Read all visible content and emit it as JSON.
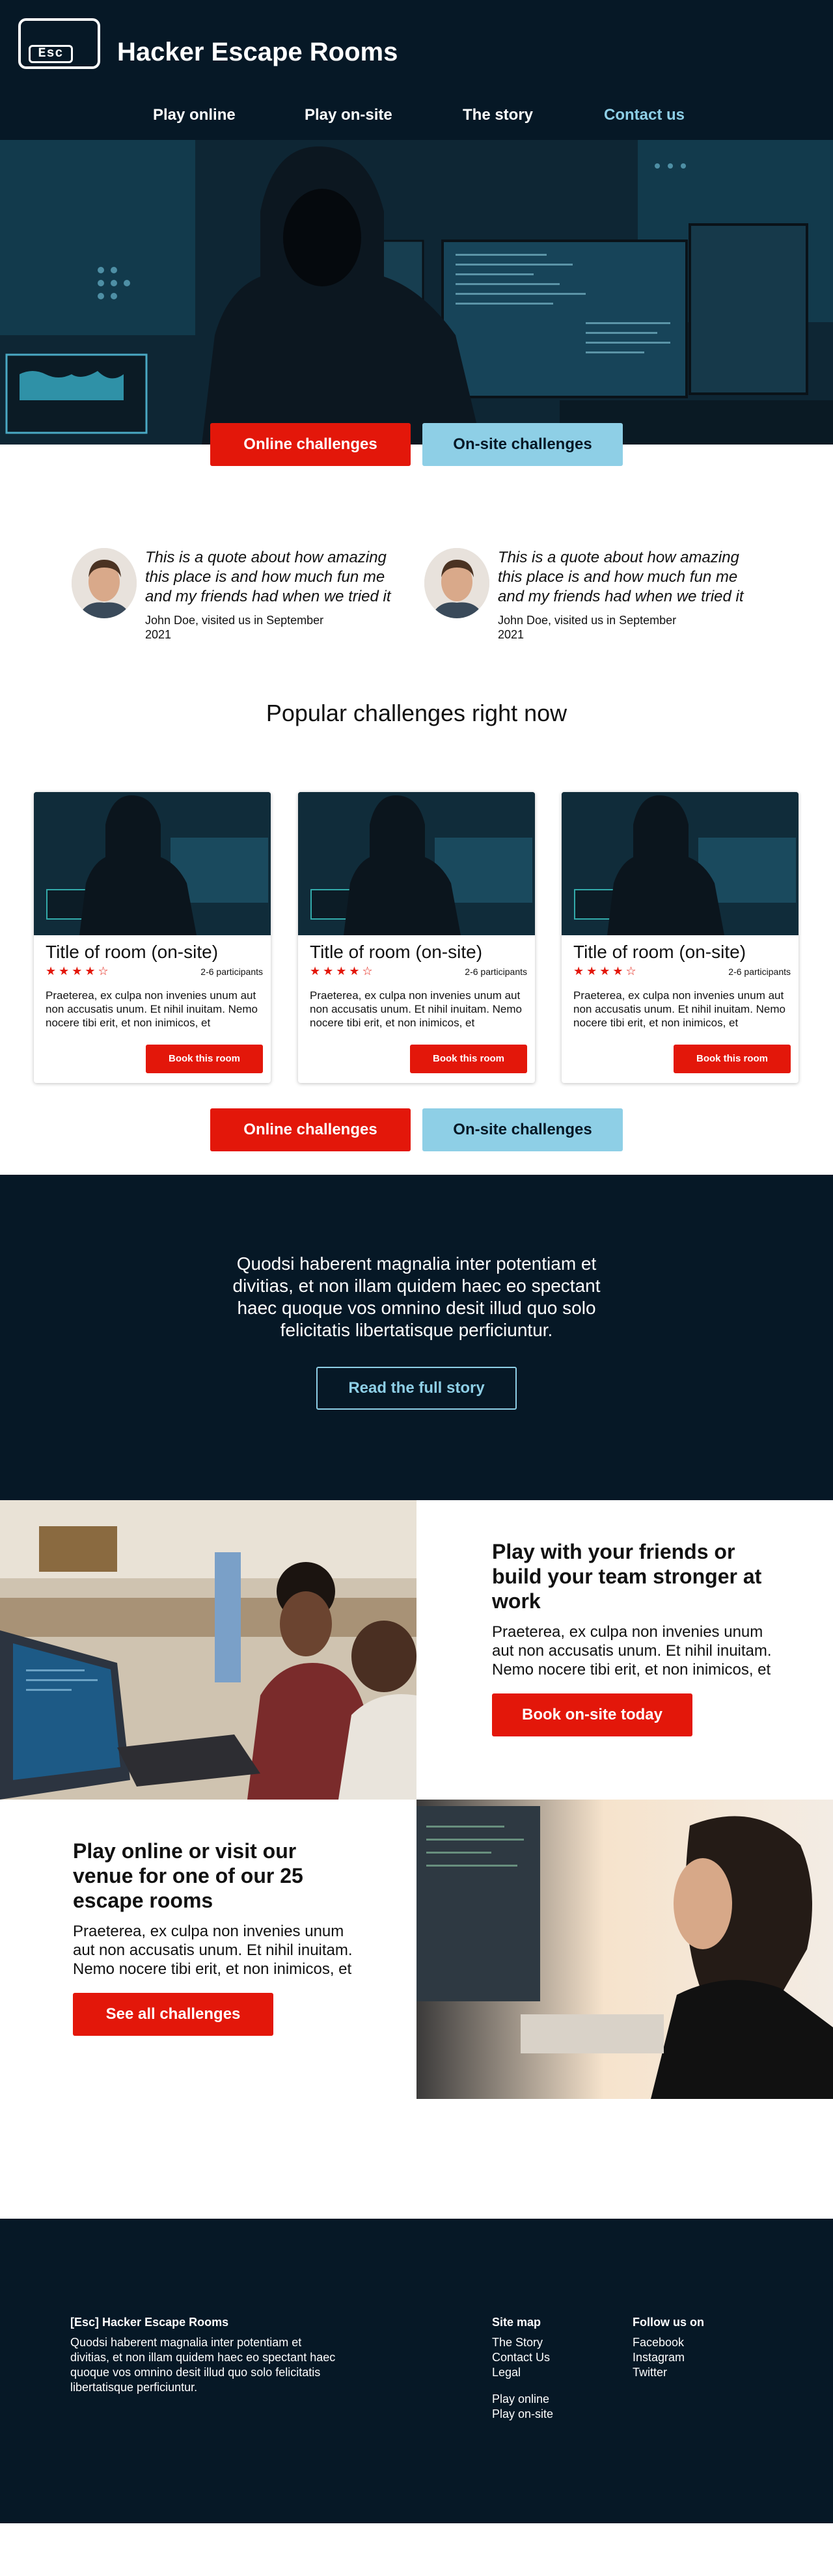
{
  "header": {
    "logo_key": "Esc",
    "brand": "Hacker Escape Rooms",
    "nav": [
      {
        "label": "Play online"
      },
      {
        "label": "Play on-site"
      },
      {
        "label": "The story"
      },
      {
        "label": "Contact us"
      }
    ]
  },
  "hero": {
    "buttons": {
      "online": "Online challenges",
      "onsite": "On-site challenges"
    }
  },
  "testimonials": [
    {
      "quote": "This is a quote about how amazing this place is and how much fun me and my friends had when we tried it",
      "author": "John Doe, visited us in September 2021"
    },
    {
      "quote": "This is a quote about how amazing this place is and how much fun me and my friends had when we tried it",
      "author": "John Doe, visited us in September 2021"
    }
  ],
  "popular": {
    "title": "Popular challenges right now",
    "cards": [
      {
        "title": "Title of room (on-site)",
        "rating": 4,
        "participants": "2-6 participants",
        "description": "Praeterea, ex culpa non invenies unum aut non accusatis unum. Et nihil inuitam. Nemo nocere tibi erit, et non inimicos, et",
        "button": "Book this room"
      },
      {
        "title": "Title of room (on-site)",
        "rating": 4,
        "participants": "2-6 participants",
        "description": "Praeterea, ex culpa non invenies unum aut non accusatis unum. Et nihil inuitam. Nemo nocere tibi erit, et non inimicos, et",
        "button": "Book this room"
      },
      {
        "title": "Title of room (on-site)",
        "rating": 4,
        "participants": "2-6 participants",
        "description": "Praeterea, ex culpa non invenies unum aut non accusatis unum. Et nihil inuitam. Nemo nocere tibi erit, et non inimicos, et",
        "button": "Book this room"
      }
    ],
    "buttons": {
      "online": "Online challenges",
      "onsite": "On-site challenges"
    }
  },
  "story": {
    "text": "Quodsi haberent magnalia inter potentiam et divitias, et non illam quidem haec eo spectant haec quoque vos omnino desit illud quo solo felicitatis libertatisque perficiuntur.",
    "button": "Read the full story"
  },
  "features": [
    {
      "title": "Play with your friends or build your team stronger at work",
      "description": "Praeterea, ex culpa non invenies unum aut non accusatis unum. Et nihil inuitam. Nemo nocere tibi erit, et non inimicos, et",
      "button": "Book on-site today"
    },
    {
      "title": "Play online or visit our venue for one of our 25 escape rooms",
      "description": "Praeterea, ex culpa non invenies unum aut non accusatis unum. Et nihil inuitam. Nemo nocere tibi erit, et non inimicos, et",
      "button": "See all challenges"
    }
  ],
  "footer": {
    "about_title": "[Esc] Hacker Escape Rooms",
    "about_text": "Quodsi haberent magnalia inter potentiam et divitias, et non illam quidem haec eo spectant haec quoque vos omnino desit illud quo solo felicitatis libertatisque perficiuntur.",
    "sitemap_title": "Site map",
    "sitemap": [
      "The Story",
      "Contact Us",
      "Legal"
    ],
    "sitemap_extra": [
      "Play online",
      "Play on-site"
    ],
    "follow_title": "Follow us on",
    "follow": [
      "Facebook",
      "Instagram",
      "Twitter"
    ]
  },
  "colors": {
    "navy": "#061826",
    "red": "#e3170a",
    "light_blue": "#8ecfe6"
  }
}
